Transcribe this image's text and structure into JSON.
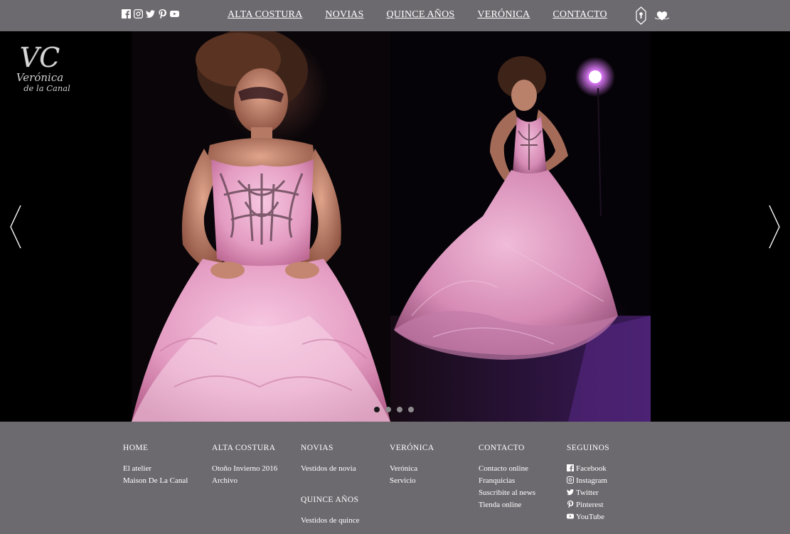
{
  "header": {
    "social_icons": [
      "facebook-icon",
      "instagram-icon",
      "twitter-icon",
      "pinterest-icon",
      "youtube-icon"
    ],
    "nav": [
      "ALTA COSTURA",
      "NOVIAS",
      "QUINCE AÑOS",
      "VERÓNICA",
      "CONTACTO"
    ],
    "right_icons": [
      "keyhole-icon",
      "heart-icon"
    ]
  },
  "hero": {
    "logo": {
      "monogram": "VC",
      "name_line1": "Verónica",
      "name_line2": "de la Canal"
    },
    "slides_count": 4,
    "active_slide": 1,
    "colors": {
      "gown": "#e8a2c6",
      "background": "#000000",
      "spotlight": "#d060ff"
    }
  },
  "footer": {
    "columns": [
      {
        "heading": "HOME",
        "items": [
          "El atelier",
          "Maison De La Canal"
        ]
      },
      {
        "heading": "ALTA COSTURA",
        "items": [
          "Otoño Invierno 2016",
          "Archivo"
        ]
      },
      {
        "heading": "NOVIAS",
        "items": [
          "Vestidos de novia"
        ],
        "sub_heading": "QUINCE AÑOS",
        "sub_items": [
          "Vestidos de quince"
        ]
      },
      {
        "heading": "VERÓNICA",
        "items": [
          "Verónica",
          "Servicio"
        ]
      },
      {
        "heading": "CONTACTO",
        "items": [
          "Contacto online",
          "Franquicias",
          "Suscribite al news",
          "Tienda online"
        ]
      },
      {
        "heading": "SEGUINOS",
        "items": [
          "Facebook",
          "Instagram",
          "Twitter",
          "Pinterest",
          "YouTube"
        ]
      }
    ]
  },
  "theme": {
    "bar_bg": "#6d6a6f",
    "text": "#ffffff"
  }
}
